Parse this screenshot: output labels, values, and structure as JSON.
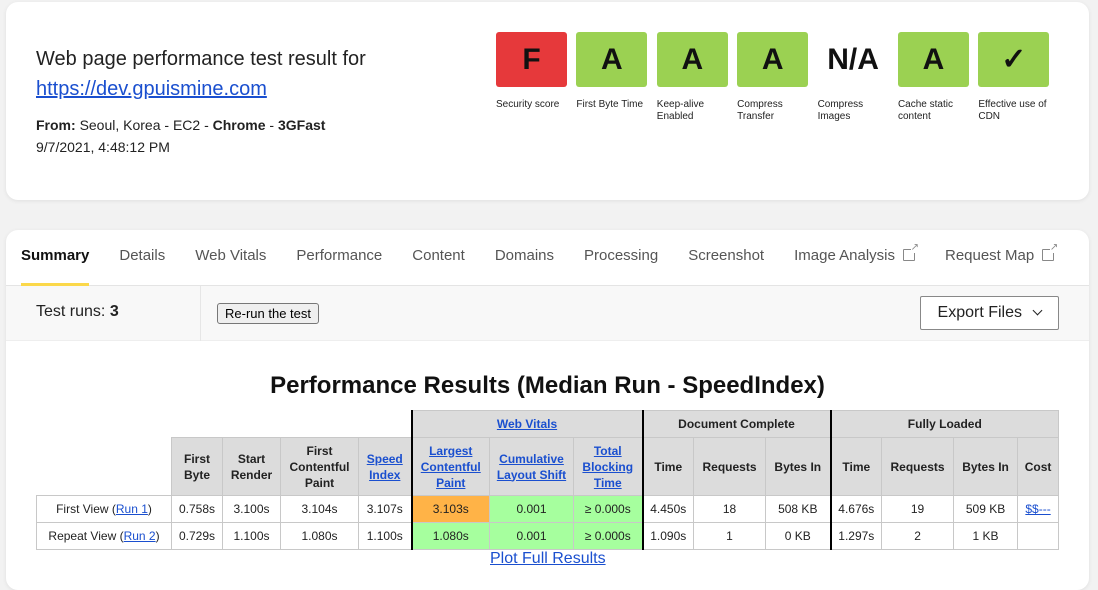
{
  "header": {
    "title": "Web page performance test result for",
    "url": "https://dev.gpuismine.com",
    "from_label": "From:",
    "from_location": "Seoul, Korea - EC2 - ",
    "browser": "Chrome",
    "sep": " - ",
    "connection": "3GFast",
    "date": "9/7/2021, 4:48:12 PM"
  },
  "grades": [
    {
      "grade": "F",
      "label": "Security score",
      "color": "#e6393b"
    },
    {
      "grade": "A",
      "label": "First Byte Time",
      "color": "#9bd152"
    },
    {
      "grade": "A",
      "label": "Keep-alive Enabled",
      "color": "#9bd152"
    },
    {
      "grade": "A",
      "label": "Compress Transfer",
      "color": "#9bd152"
    },
    {
      "grade": "N/A",
      "label": "Compress Images",
      "color": "#ffffff"
    },
    {
      "grade": "A",
      "label": "Cache static content",
      "color": "#9bd152"
    },
    {
      "grade": "✓",
      "label": "Effective use of CDN",
      "color": "#9bd152"
    }
  ],
  "tabs": [
    "Summary",
    "Details",
    "Web Vitals",
    "Performance",
    "Content",
    "Domains",
    "Processing",
    "Screenshot",
    "Image Analysis",
    "Request Map"
  ],
  "toolbar": {
    "runs_label": "Test runs:",
    "runs": "3",
    "rerun": "Re-run the test",
    "export": "Export Files"
  },
  "results": {
    "title": "Performance Results (Median Run - SpeedIndex)",
    "groups": {
      "web_vitals": "Web Vitals",
      "doc": "Document Complete",
      "full": "Fully Loaded"
    },
    "headers": [
      "First Byte",
      "Start Render",
      "First Contentful Paint",
      "Speed Index",
      "Largest Contentful Paint",
      "Cumulative Layout Shift",
      "Total Blocking Time",
      "Time",
      "Requests",
      "Bytes In",
      "Time",
      "Requests",
      "Bytes In",
      "Cost"
    ],
    "rows": [
      {
        "label": "First View (",
        "run": "Run 1",
        "close": ")",
        "cells": [
          "0.758s",
          "3.100s",
          "3.104s",
          "3.107s",
          "3.103s",
          "0.001",
          "≥ 0.000s",
          "4.450s",
          "18",
          "508 KB",
          "4.676s",
          "19",
          "509 KB",
          "$$---"
        ]
      },
      {
        "label": "Repeat View (",
        "run": "Run 2",
        "close": ")",
        "cells": [
          "0.729s",
          "1.100s",
          "1.080s",
          "1.100s",
          "1.080s",
          "0.001",
          "≥ 0.000s",
          "1.090s",
          "1",
          "0 KB",
          "1.297s",
          "2",
          "1 KB",
          ""
        ]
      }
    ],
    "plot": "Plot Full Results"
  }
}
